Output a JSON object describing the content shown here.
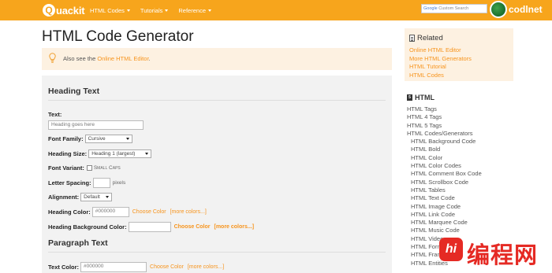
{
  "header": {
    "logo_letter": "Q",
    "logo_text": "uackit",
    "nav": [
      "HTML Codes",
      "Tutorials",
      "Reference"
    ],
    "search_text": "Custom Search",
    "search_brand": "Google",
    "brand_text": "codlnet"
  },
  "main": {
    "title": "HTML Code Generator",
    "tip_prefix": "Also see the ",
    "tip_link": "Online HTML Editor",
    "tip_suffix": "."
  },
  "heading_section": {
    "title": "Heading Text",
    "text_label": "Text:",
    "text_placeholder": "Heading goes here",
    "font_family_label": "Font Family:",
    "font_family_value": "Cursive",
    "heading_size_label": "Heading Size:",
    "heading_size_value": "Heading 1 (largest)",
    "font_variant_label": "Font Variant:",
    "font_variant_option": "Small Caps",
    "letter_spacing_label": "Letter Spacing:",
    "letter_spacing_unit": "pixels",
    "alignment_label": "Alignment:",
    "alignment_value": "Default",
    "heading_color_label": "Heading Color:",
    "heading_color_value": "#000000",
    "choose_color": "Choose Color",
    "more_colors": "[more colors...]",
    "bg_color_label": "Heading Background Color:",
    "bg_choose_color": "Choose Color",
    "bg_more_colors": "[more colors...]"
  },
  "paragraph_section": {
    "title": "Paragraph Text",
    "text_color_label": "Text Color:",
    "text_color_value": "#000000",
    "choose_color": "Choose Color",
    "more_colors": "[more colors...]"
  },
  "sidebar": {
    "related_title": "Related",
    "related_links": [
      "Online HTML Editor",
      "More HTML Generators",
      "HTML Tutorial",
      "HTML Codes"
    ],
    "html_title": "HTML",
    "html_icon": "5",
    "html_links": [
      "HTML Tags",
      "HTML 4 Tags",
      "HTML 5 Tags",
      "HTML Codes/Generators"
    ],
    "html_sub_links": [
      "HTML Background Code",
      "HTML Bold",
      "HTML Color",
      "HTML Color Codes",
      "HTML Comment Box Code",
      "HTML Scrollbox Code",
      "HTML Tables",
      "HTML Text Code",
      "HTML Image Code",
      "HTML Link Code",
      "HTML Marquee Code",
      "HTML Music Code",
      "HTML Video",
      "HTML Form",
      "HTML Frame",
      "HTML Entities"
    ]
  },
  "watermark": {
    "badge": "hi",
    "text": "编程网"
  },
  "colors": {
    "brand_orange": "#f7a51c",
    "link_orange": "#f7941d",
    "tip_bg": "#fdf1e1",
    "panel_bg": "#f2f2f2"
  }
}
